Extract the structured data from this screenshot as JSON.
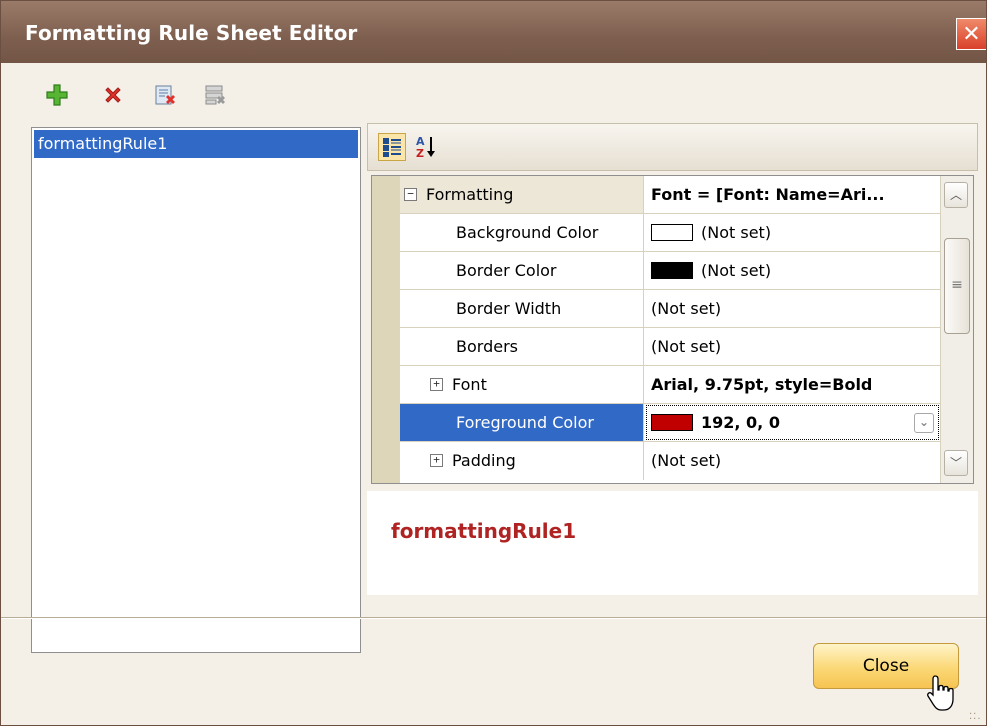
{
  "window": {
    "title": "Formatting Rule Sheet Editor"
  },
  "toolbar": {
    "add_icon": "plus-icon",
    "delete_icon": "delete-x-icon",
    "purge_icon": "purge-icon",
    "purge_all_icon": "purge-all-icon"
  },
  "rules": {
    "items": [
      "formattingRule1"
    ]
  },
  "property_grid": {
    "toolbar": {
      "categorized_icon": "categorized-icon",
      "alphabetical_icon": "sort-az-icon"
    },
    "rows": [
      {
        "name": "Formatting",
        "value": "Font = [Font: Name=Ari...",
        "expander": "−",
        "category": true
      },
      {
        "name": "Background Color",
        "value": "(Not set)",
        "swatch": "#ffffff"
      },
      {
        "name": "Border Color",
        "value": "(Not set)",
        "swatch": "#000000"
      },
      {
        "name": "Border Width",
        "value": "(Not set)"
      },
      {
        "name": "Borders",
        "value": "(Not set)"
      },
      {
        "name": "Font",
        "value": "Arial, 9.75pt, style=Bold",
        "expander": "+"
      },
      {
        "name": "Foreground Color",
        "value": "192, 0, 0",
        "swatch": "#c00000",
        "selected": true
      },
      {
        "name": "Padding",
        "value": "(Not set)",
        "expander": "+"
      }
    ]
  },
  "description": {
    "title": "formattingRule1"
  },
  "footer": {
    "close_label": "Close"
  },
  "colors": {
    "selection": "#3169c6",
    "description_title": "#b02323",
    "close_button": "#fbd876"
  }
}
